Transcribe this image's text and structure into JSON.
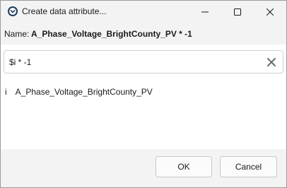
{
  "window": {
    "title": "Create data attribute...",
    "icons": {
      "app": "app-logo-icon",
      "minimize": "minimize-icon",
      "maximize": "maximize-icon",
      "close": "close-icon"
    }
  },
  "name_row": {
    "label": "Name:",
    "value": "A_Phase_Voltage_BrightCounty_PV * -1"
  },
  "expression": {
    "value": "$i * -1",
    "clear_icon": "clear-x-icon"
  },
  "variables": [
    {
      "key": "i",
      "name": "A_Phase_Voltage_BrightCounty_PV"
    }
  ],
  "buttons": {
    "ok": "OK",
    "cancel": "Cancel"
  }
}
